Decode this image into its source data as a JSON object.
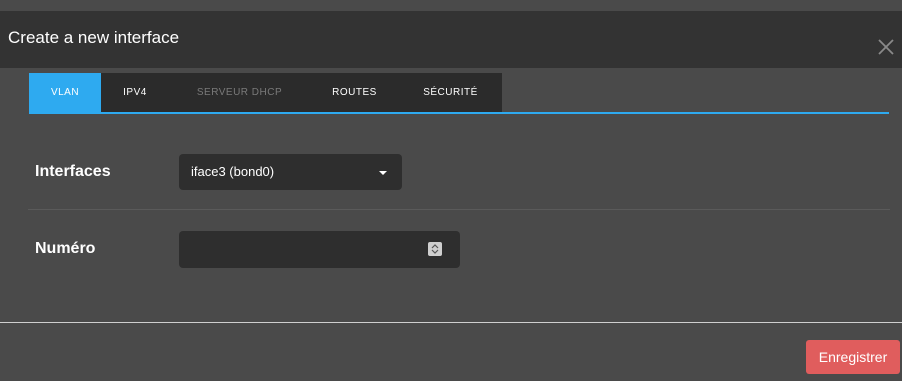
{
  "modal": {
    "title": "Create a new interface"
  },
  "tabs": [
    {
      "label": "VLAN",
      "state": "active"
    },
    {
      "label": "IPV4",
      "state": "normal"
    },
    {
      "label": "SERVEUR DHCP",
      "state": "disabled"
    },
    {
      "label": "ROUTES",
      "state": "normal"
    },
    {
      "label": "SÉCURITÉ",
      "state": "normal"
    }
  ],
  "form": {
    "interfaces_label": "Interfaces",
    "interfaces_value": "iface3 (bond0)",
    "numero_label": "Numéro",
    "numero_value": ""
  },
  "footer": {
    "save_label": "Enregistrer"
  },
  "icons": {
    "close": "close-icon",
    "caret": "chevron-down-icon",
    "spinner": "spinner-icon"
  },
  "colors": {
    "accent": "#2eaaf0",
    "save": "#e05d5d",
    "header": "#333333",
    "body": "#4a4a4a"
  }
}
